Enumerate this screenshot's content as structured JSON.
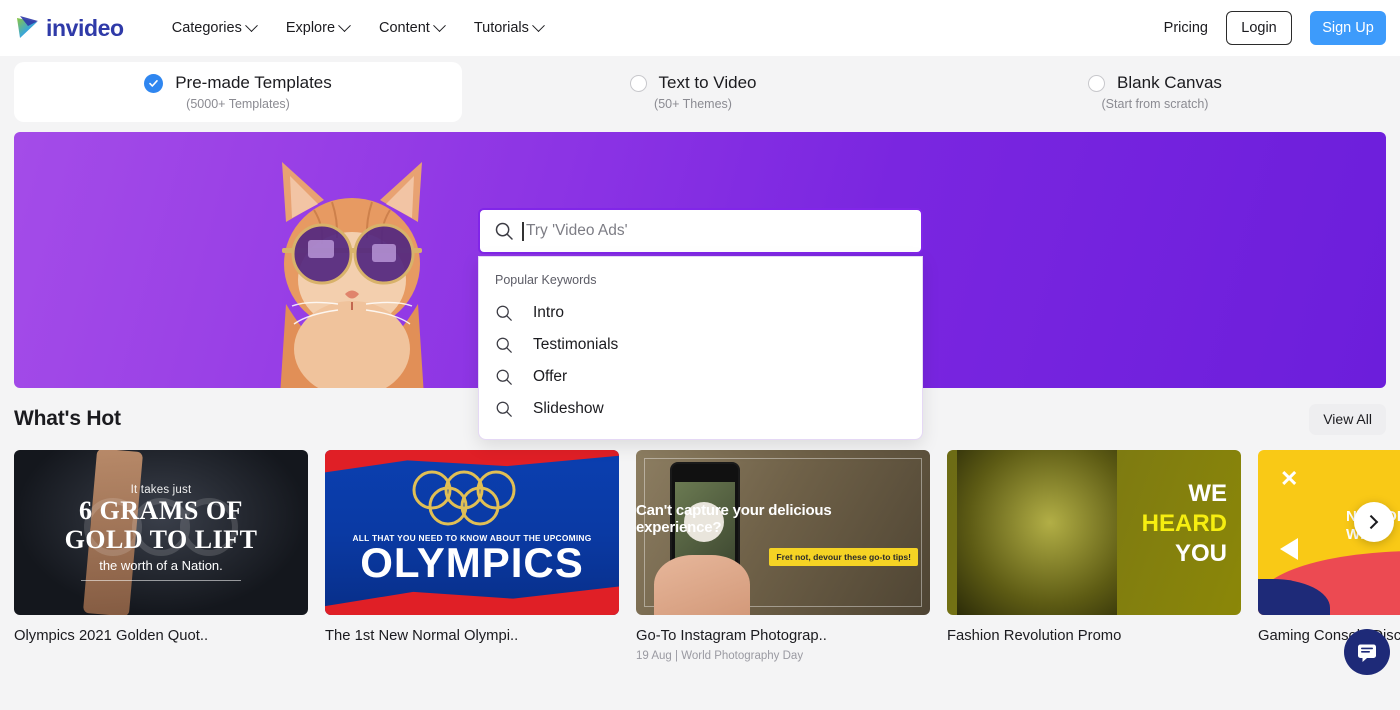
{
  "header": {
    "brand": "invideo",
    "nav": [
      {
        "label": "Categories",
        "icon": "chevron-down-icon"
      },
      {
        "label": "Explore",
        "icon": "chevron-down-icon"
      },
      {
        "label": "Content",
        "icon": "chevron-down-icon"
      },
      {
        "label": "Tutorials",
        "icon": "chevron-down-icon"
      }
    ],
    "pricing_label": "Pricing",
    "login_label": "Login",
    "signup_label": "Sign Up",
    "signup_color": "#3d9bfb",
    "brand_color": "#2f3aa8"
  },
  "modes": [
    {
      "label": "Pre-made Templates",
      "sub": "(5000+ Templates)",
      "selected": true
    },
    {
      "label": "Text to Video",
      "sub": "(50+ Themes)",
      "selected": false
    },
    {
      "label": "Blank Canvas",
      "sub": "(Start from scratch)",
      "selected": false
    }
  ],
  "hero": {
    "background_color": "#8b33e4",
    "image_alt": "cat-with-sunglasses"
  },
  "search": {
    "placeholder": "Try 'Video Ads'",
    "value": "",
    "icon": "search-icon",
    "border_color": "#8126e8",
    "dropdown_title": "Popular Keywords",
    "suggestions": [
      {
        "label": "Intro",
        "icon": "search-icon"
      },
      {
        "label": "Testimonials",
        "icon": "search-icon"
      },
      {
        "label": "Offer",
        "icon": "search-icon"
      },
      {
        "label": "Slideshow",
        "icon": "search-icon"
      }
    ]
  },
  "whats_hot": {
    "title": "What's Hot",
    "view_all_label": "View All",
    "next_icon": "chevron-right-icon",
    "cards": [
      {
        "title": "Olympics 2021 Golden Quot..",
        "sub": "",
        "thumb_text": {
          "line1": "It takes just",
          "line2a": "6 GRAMS OF",
          "line2b": "GOLD TO LIFT",
          "line3": "the worth of a Nation."
        }
      },
      {
        "title": "The 1st New Normal Olympi..",
        "sub": "",
        "thumb_text": {
          "caption": "ALL THAT YOU NEED TO KNOW ABOUT THE UPCOMING",
          "headline": "OLYMPICS"
        }
      },
      {
        "title": "Go-To Instagram Photograp..",
        "sub": "19 Aug | World Photography Day",
        "thumb_text": {
          "question": "Can't capture your delicious experience?",
          "tag": "Fret not, devour these go-to tips!"
        }
      },
      {
        "title": "Fashion Revolution Promo",
        "sub": "",
        "thumb_text": {
          "w1": "WE",
          "w2": "HEARD",
          "w3": "YOU"
        }
      },
      {
        "title": "Gaming Console Discount Promo",
        "sub": "",
        "thumb_text": {
          "line1": "NO MORE",
          "line2": "WITH"
        }
      }
    ]
  },
  "chat": {
    "icon": "chat-bubble-icon",
    "color": "#1e2a78"
  }
}
